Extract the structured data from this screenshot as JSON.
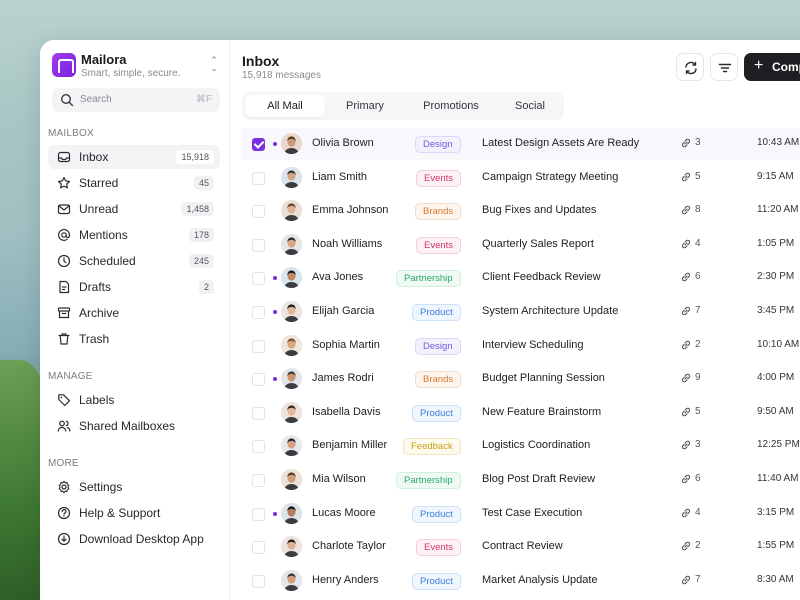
{
  "sidebar": {
    "brand": {
      "name": "Mailora",
      "tagline": "Smart, simple, secure."
    },
    "search": {
      "placeholder": "Search",
      "shortcut": "⌘F"
    },
    "sections": {
      "mailbox": "MAILBOX",
      "manage": "MANAGE",
      "more": "MORE"
    },
    "mailbox_items": [
      {
        "label": "Inbox",
        "count": "15,918",
        "icon": "inbox-icon",
        "active": true
      },
      {
        "label": "Starred",
        "count": "45",
        "icon": "star-icon"
      },
      {
        "label": "Unread",
        "count": "1,458",
        "icon": "mail-icon"
      },
      {
        "label": "Mentions",
        "count": "178",
        "icon": "at-icon"
      },
      {
        "label": "Scheduled",
        "count": "245",
        "icon": "clock-icon"
      },
      {
        "label": "Drafts",
        "count": "2",
        "icon": "draft-icon"
      },
      {
        "label": "Archive",
        "icon": "archive-icon"
      },
      {
        "label": "Trash",
        "icon": "trash-icon"
      }
    ],
    "manage_items": [
      {
        "label": "Labels",
        "icon": "tag-icon"
      },
      {
        "label": "Shared Mailboxes",
        "icon": "users-icon"
      }
    ],
    "more_items": [
      {
        "label": "Settings",
        "icon": "gear-icon"
      },
      {
        "label": "Help & Support",
        "icon": "help-icon"
      },
      {
        "label": "Download Desktop App",
        "icon": "download-icon"
      }
    ]
  },
  "main": {
    "title": "Inbox",
    "subtitle": "15,918 messages",
    "compose_label": "Comp",
    "tabs": [
      "All Mail",
      "Primary",
      "Promotions",
      "Social"
    ],
    "active_tab": 0
  },
  "tag_colors": {
    "Design": {
      "fg": "#6d5fd6",
      "bg": "#f3f1fd",
      "border": "#dcd6fa"
    },
    "Events": {
      "fg": "#d2356d",
      "bg": "#fdf1f5",
      "border": "#f6cfdc"
    },
    "Brands": {
      "fg": "#d9762a",
      "bg": "#fdf5ee",
      "border": "#f4dcc6"
    },
    "Partnership": {
      "fg": "#2fa66a",
      "bg": "#f0faf4",
      "border": "#cfeedd"
    },
    "Product": {
      "fg": "#3a7fd6",
      "bg": "#f0f6fd",
      "border": "#cfe1f6"
    },
    "Feedback": {
      "fg": "#c4a01a",
      "bg": "#fdfaee",
      "border": "#f1e6bd"
    }
  },
  "messages": [
    {
      "sender": "Olivia Brown",
      "tag": "Design",
      "subject": "Latest Design Assets Are Ready",
      "attachments": "3",
      "time": "10:43 AM",
      "checked": true,
      "unread": true
    },
    {
      "sender": "Liam Smith",
      "tag": "Events",
      "subject": "Campaign Strategy Meeting",
      "attachments": "5",
      "time": "9:15 AM"
    },
    {
      "sender": "Emma Johnson",
      "tag": "Brands",
      "subject": "Bug Fixes and Updates",
      "attachments": "8",
      "time": "11:20 AM"
    },
    {
      "sender": "Noah Williams",
      "tag": "Events",
      "subject": "Quarterly Sales Report",
      "attachments": "4",
      "time": "1:05 PM"
    },
    {
      "sender": "Ava Jones",
      "tag": "Partnership",
      "subject": "Client Feedback Review",
      "attachments": "6",
      "time": "2:30 PM",
      "unread": true
    },
    {
      "sender": "Elijah Garcia",
      "tag": "Product",
      "subject": "System Architecture Update",
      "attachments": "7",
      "time": "3:45 PM",
      "unread": true
    },
    {
      "sender": "Sophia Martin",
      "tag": "Design",
      "subject": "Interview Scheduling",
      "attachments": "2",
      "time": "10:10 AM"
    },
    {
      "sender": "James Rodri",
      "tag": "Brands",
      "subject": "Budget Planning Session",
      "attachments": "9",
      "time": "4:00 PM",
      "unread": true
    },
    {
      "sender": "Isabella Davis",
      "tag": "Product",
      "subject": "New Feature Brainstorm",
      "attachments": "5",
      "time": "9:50 AM"
    },
    {
      "sender": "Benjamin Miller",
      "tag": "Feedback",
      "subject": "Logistics Coordination",
      "attachments": "3",
      "time": "12:25 PM"
    },
    {
      "sender": "Mia Wilson",
      "tag": "Partnership",
      "subject": "Blog Post Draft Review",
      "attachments": "6",
      "time": "11:40 AM"
    },
    {
      "sender": "Lucas Moore",
      "tag": "Product",
      "subject": "Test Case Execution",
      "attachments": "4",
      "time": "3:15 PM",
      "unread": true
    },
    {
      "sender": "Charlote Taylor",
      "tag": "Events",
      "subject": "Contract Review",
      "attachments": "2",
      "time": "1:55 PM"
    },
    {
      "sender": "Henry Anders",
      "tag": "Product",
      "subject": "Market Analysis Update",
      "attachments": "7",
      "time": "8:30 AM"
    }
  ]
}
